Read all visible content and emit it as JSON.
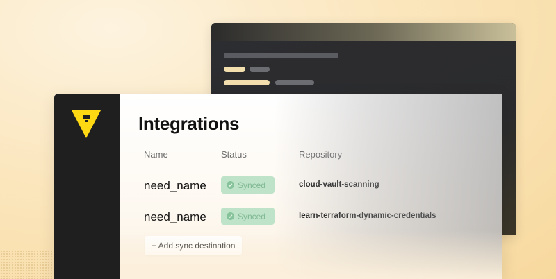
{
  "page": {
    "title": "Integrations"
  },
  "table": {
    "columns": [
      "Name",
      "Status",
      "Repository"
    ],
    "rows": [
      {
        "name": "need_name",
        "status": "Synced",
        "repository": "cloud-vault-scanning"
      },
      {
        "name": "need_name",
        "status": "Synced",
        "repository": "learn-terraform-dynamic-credentials"
      }
    ]
  },
  "actions": {
    "add_sync_label": "+ Add sync destination"
  },
  "icons": {
    "logo": "vault-logo-icon",
    "status": "check-circle-icon"
  },
  "colors": {
    "brand_yellow": "#ffd814",
    "sidebar": "#1f1f1f",
    "synced_badge_bg": "#bfe3c9",
    "synced_text": "#7fb893"
  }
}
